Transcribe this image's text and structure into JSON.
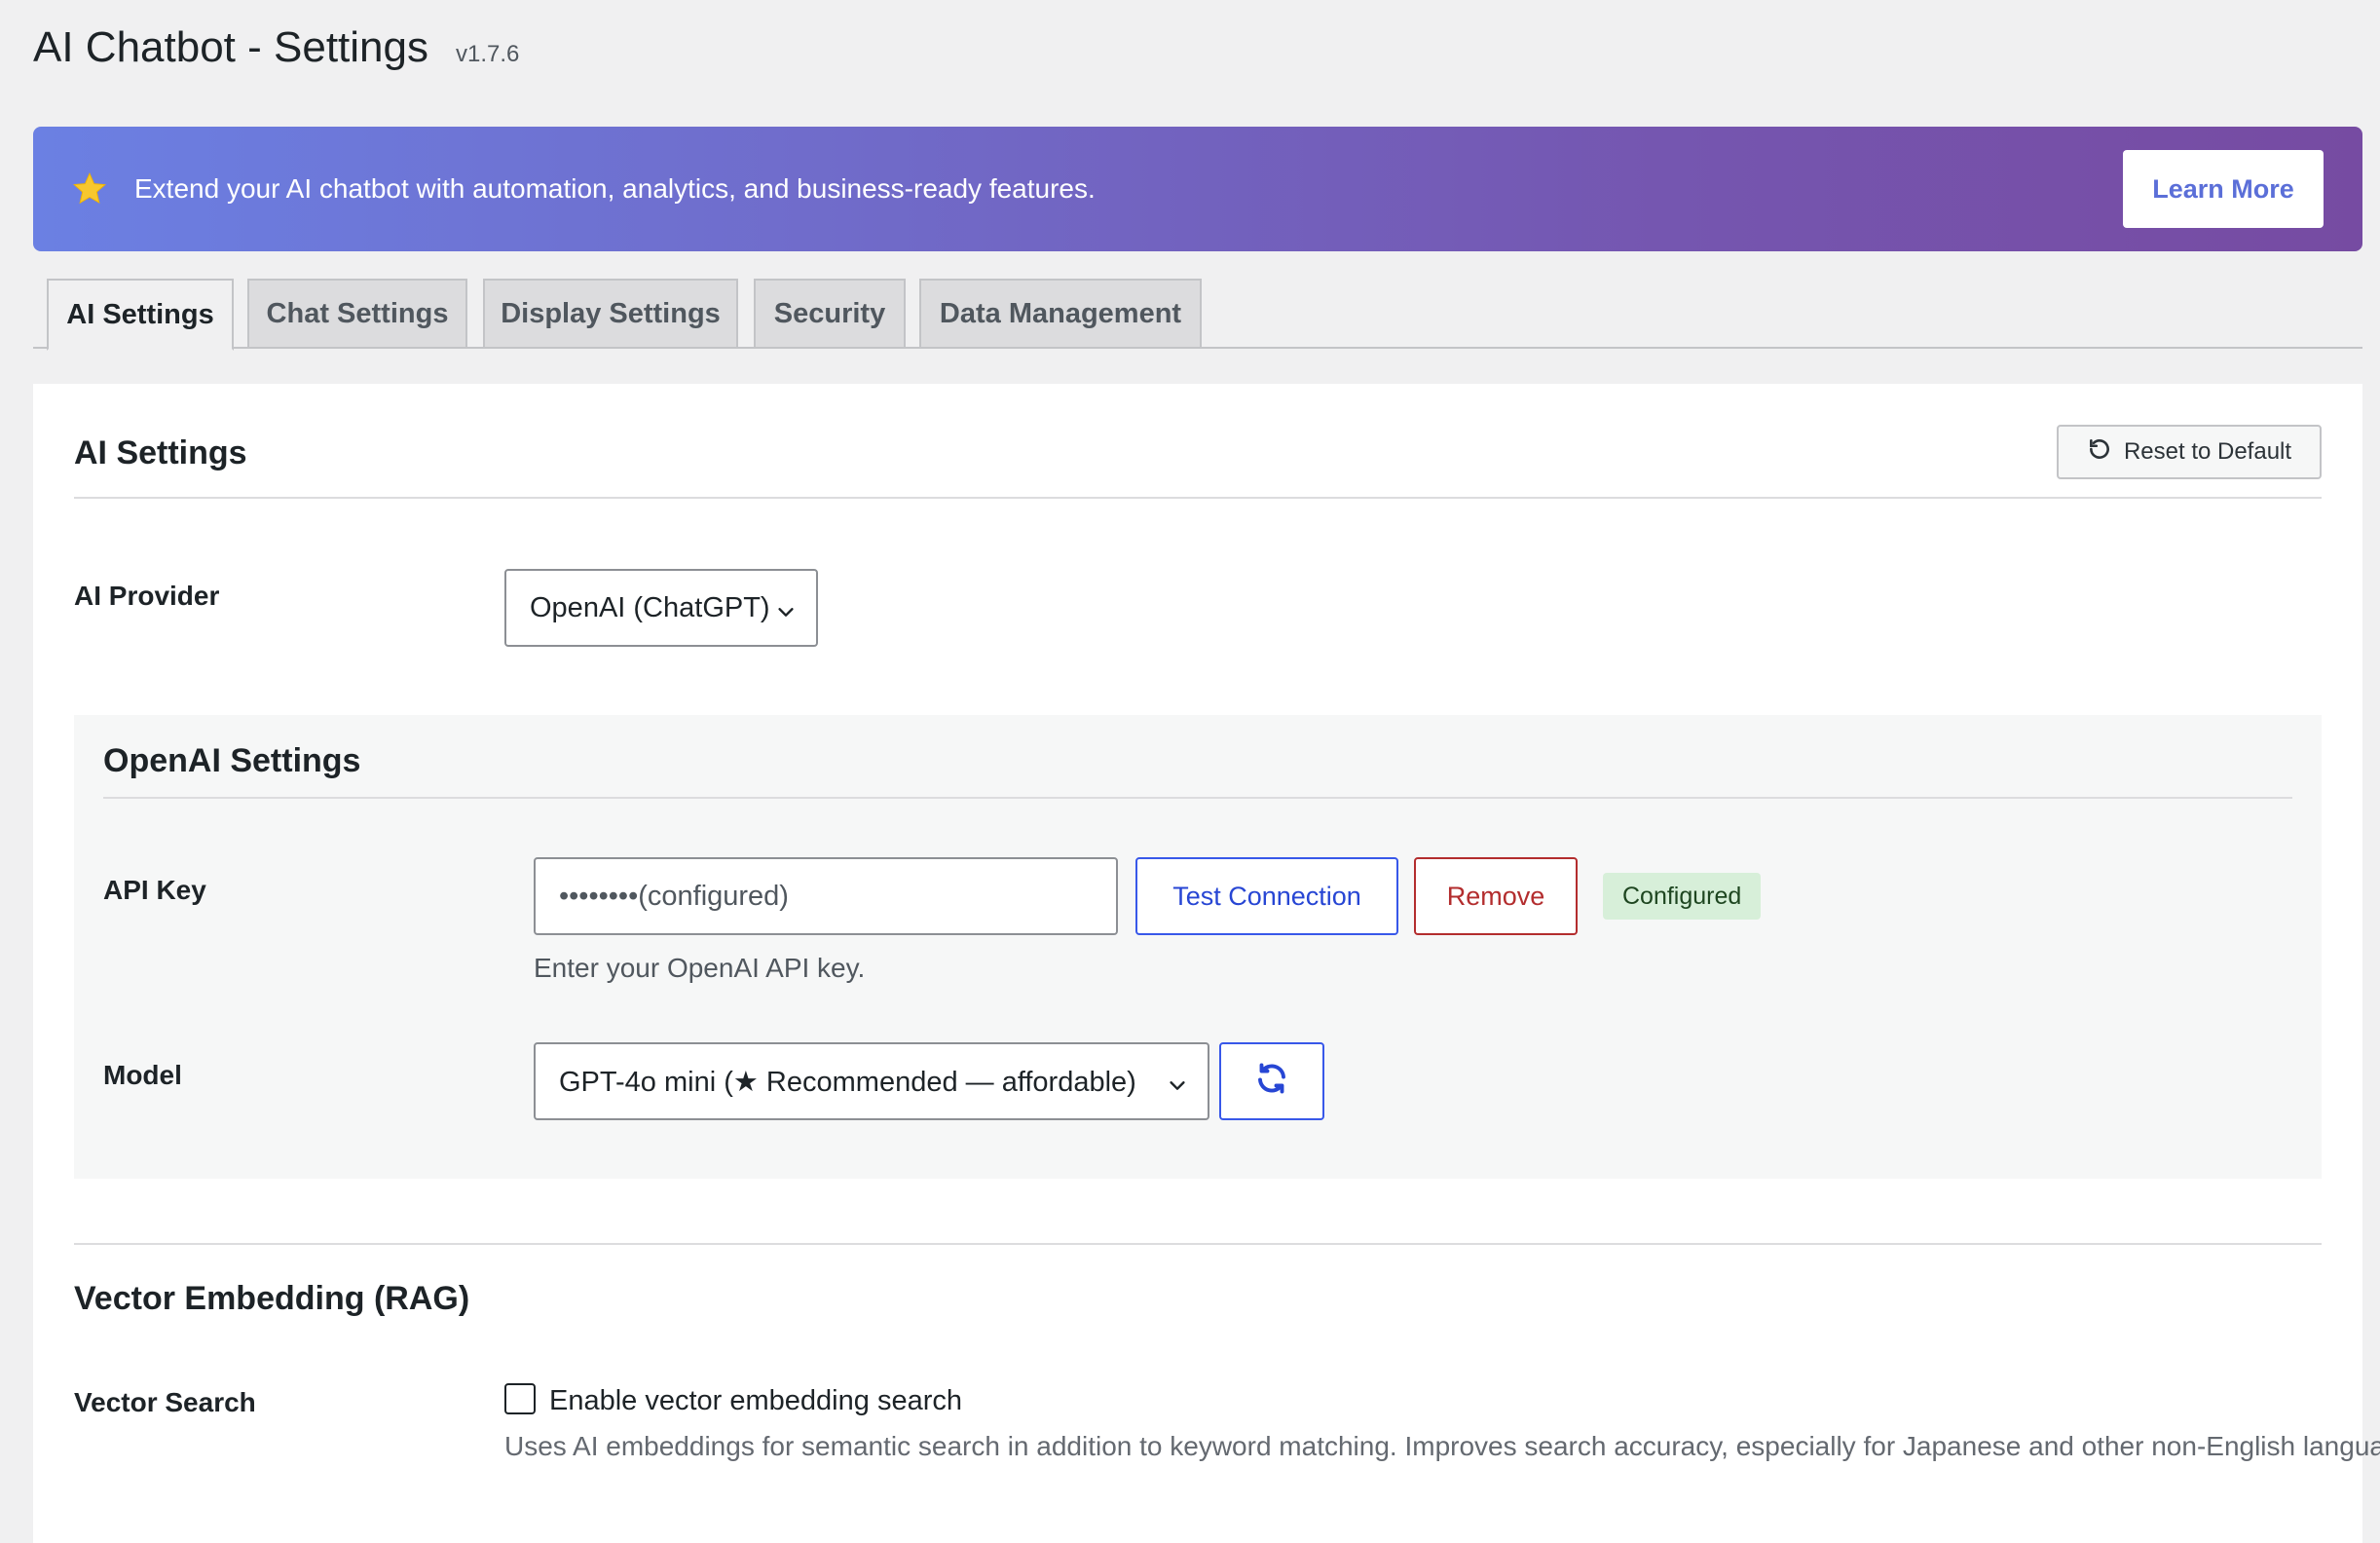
{
  "header": {
    "title": "AI Chatbot - Settings",
    "version": "v1.7.6"
  },
  "banner": {
    "icon": "star-icon",
    "text": "Extend your AI chatbot with automation, analytics, and business-ready features.",
    "button_label": "Learn More"
  },
  "tabs": [
    {
      "label": "AI Settings",
      "active": true
    },
    {
      "label": "Chat Settings",
      "active": false
    },
    {
      "label": "Display Settings",
      "active": false
    },
    {
      "label": "Security",
      "active": false
    },
    {
      "label": "Data Management",
      "active": false
    }
  ],
  "ai_settings": {
    "title": "AI Settings",
    "reset_label": "Reset to Default",
    "provider": {
      "label": "AI Provider",
      "value": "OpenAI (ChatGPT)"
    }
  },
  "openai": {
    "title": "OpenAI Settings",
    "api_key": {
      "label": "API Key",
      "value": "••••••••(configured)",
      "help": "Enter your OpenAI API key.",
      "test_label": "Test Connection",
      "remove_label": "Remove",
      "status": "Configured"
    },
    "model": {
      "label": "Model",
      "value": "GPT-4o mini (★ Recommended — affordable)",
      "refresh_icon": "refresh-icon"
    }
  },
  "vector": {
    "title": "Vector Embedding (RAG)",
    "label": "Vector Search",
    "checkbox_label": "Enable vector embedding search",
    "checked": false,
    "description": "Uses AI embeddings for semantic search in addition to keyword matching. Improves search accuracy, especially for Japanese and other non-English languages."
  },
  "colors": {
    "accent": "#3858e9",
    "danger": "#b32d2e",
    "success_bg": "#d7efd9",
    "banner_start": "#6b80e3",
    "banner_end": "#764ba2"
  }
}
